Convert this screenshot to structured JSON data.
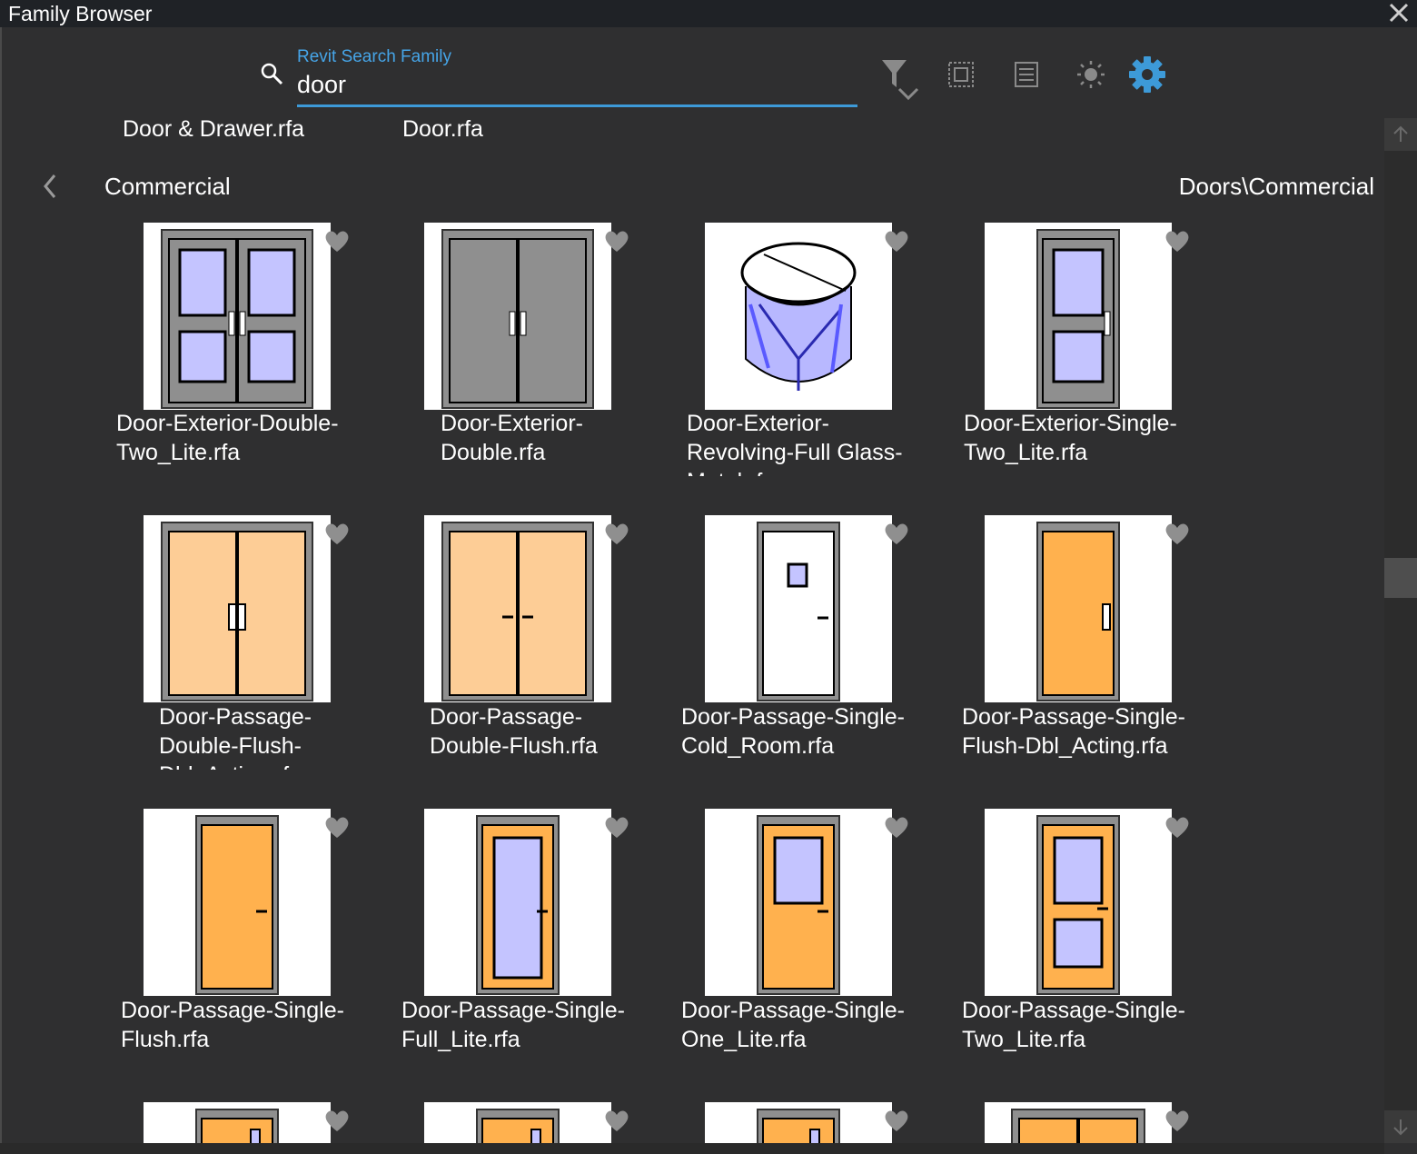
{
  "window": {
    "title": "Family Browser"
  },
  "search": {
    "label": "Revit Search Family",
    "value": "door"
  },
  "toolbar": [
    {
      "icon": "filter-icon"
    },
    {
      "icon": "select-region-icon"
    },
    {
      "icon": "list-view-icon"
    },
    {
      "icon": "brightness-icon"
    },
    {
      "icon": "settings-gear-icon",
      "color": "#3d9ad8"
    }
  ],
  "suggestions": [
    "Door & Drawer.rfa",
    "Door.rfa"
  ],
  "nav": {
    "folder": "Commercial",
    "path": "Doors\\Commercial"
  },
  "families": [
    {
      "name": "Door-Exterior-Double-Two_Lite.rfa",
      "caption1": "Door-Exterior-Double-",
      "caption2": "Two_Lite.rfa"
    },
    {
      "name": "Door-Exterior-Double.rfa",
      "caption1": "Door-Exterior-",
      "caption2": "Double.rfa"
    },
    {
      "name": "Door-Exterior-Revolving-Full Glass-Metal.rfa",
      "caption1": "Door-Exterior-",
      "caption2": "Revolving-Full Glass-",
      "caption3": "Metal.rfa"
    },
    {
      "name": "Door-Exterior-Single-Two_Lite.rfa",
      "caption1": "Door-Exterior-Single-",
      "caption2": "Two_Lite.rfa"
    },
    {
      "name": "Door-Passage-Double-Flush-Dbl_Acting.rfa",
      "caption1": "Door-Passage-",
      "caption2": "Double-Flush-",
      "caption3": "Dbl_Acting.rfa"
    },
    {
      "name": "Door-Passage-Double-Flush.rfa",
      "caption1": "Door-Passage-",
      "caption2": "Double-Flush.rfa"
    },
    {
      "name": "Door-Passage-Single-Cold_Room.rfa",
      "caption1": "Door-Passage-Single-",
      "caption2": "Cold_Room.rfa"
    },
    {
      "name": "Door-Passage-Single-Flush-Dbl_Acting.rfa",
      "caption1": "Door-Passage-Single-",
      "caption2": "Flush-Dbl_Acting.rfa"
    },
    {
      "name": "Door-Passage-Single-Flush.rfa",
      "caption1": "Door-Passage-Single-",
      "caption2": "Flush.rfa"
    },
    {
      "name": "Door-Passage-Single-Full_Lite.rfa",
      "caption1": "Door-Passage-Single-",
      "caption2": "Full_Lite.rfa"
    },
    {
      "name": "Door-Passage-Single-One_Lite.rfa",
      "caption1": "Door-Passage-Single-",
      "caption2": "One_Lite.rfa"
    },
    {
      "name": "Door-Passage-Single-Two_Lite.rfa",
      "caption1": "Door-Passage-Single-",
      "caption2": "Two_Lite.rfa"
    }
  ],
  "colors": {
    "accent": "#3d9ad8",
    "glass": "#c4c4ff",
    "wood_light": "#fdcd96",
    "wood": "#ffb14e",
    "frame": "#8f8f8f"
  }
}
